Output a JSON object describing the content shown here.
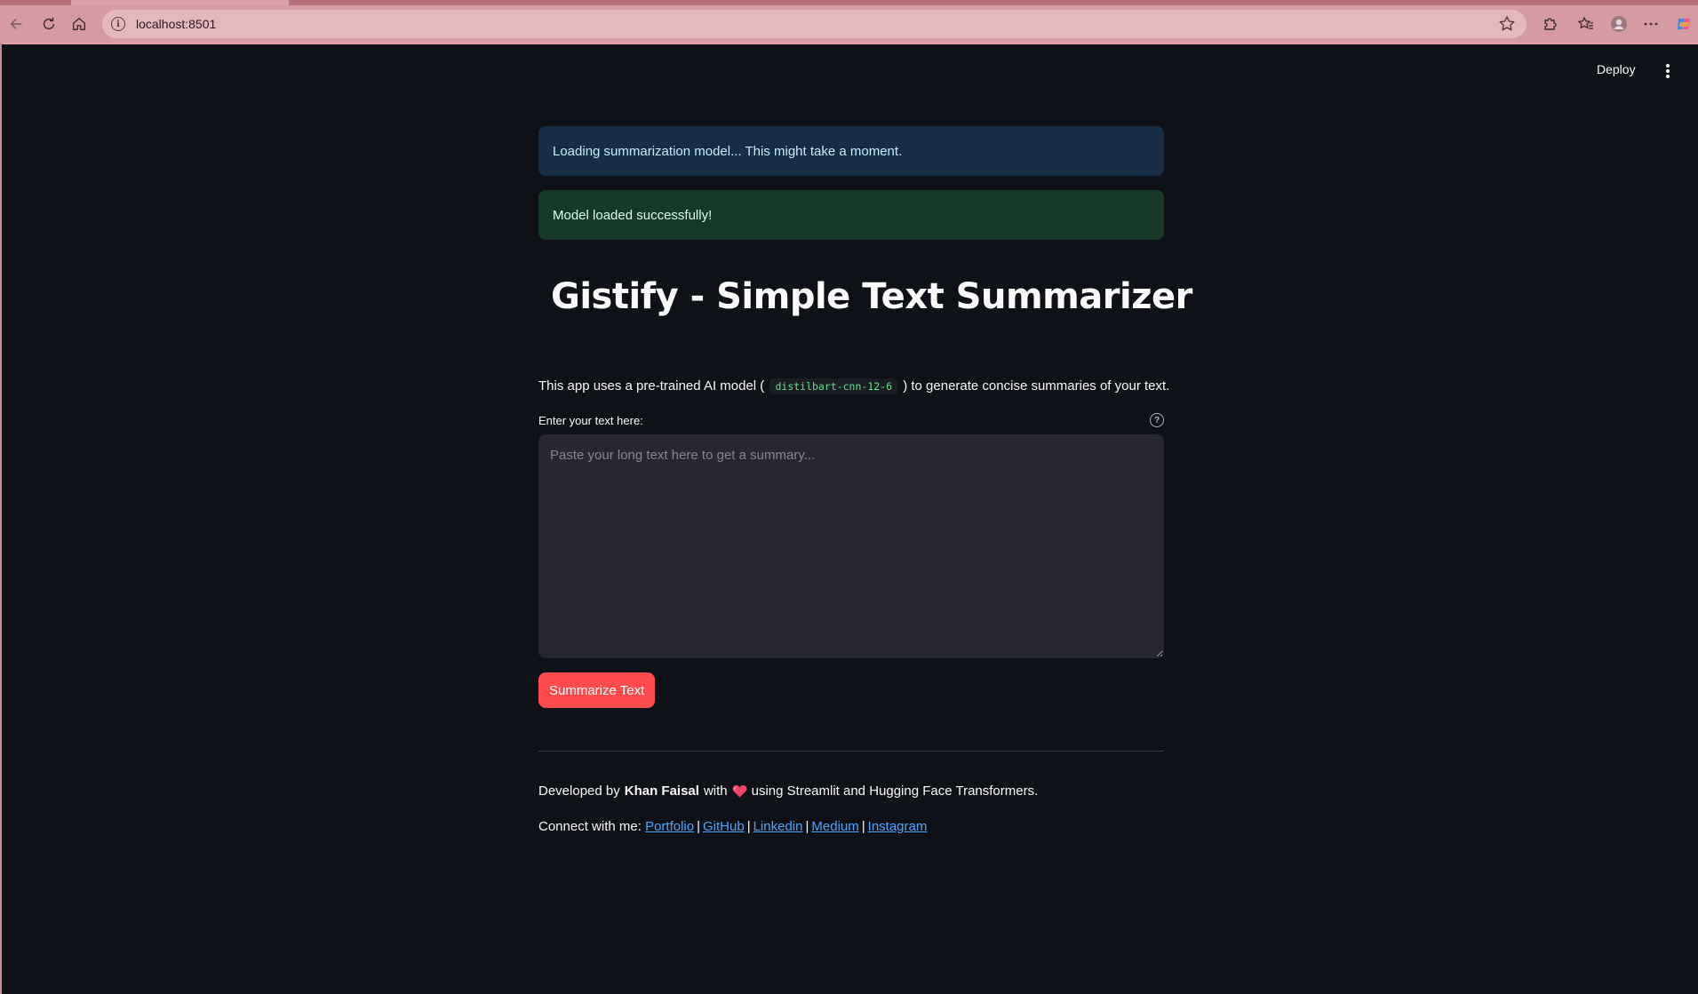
{
  "browser": {
    "url": "localhost:8501"
  },
  "header": {
    "deploy_label": "Deploy"
  },
  "alerts": {
    "info": "Loading summarization model... This might take a moment.",
    "success": "Model loaded successfully!"
  },
  "title": "Gistify - Simple Text Summarizer",
  "description": {
    "before": "This app uses a pre-trained AI model (",
    "model_code": "distilbart-cnn-12-6",
    "after": ") to generate concise summaries of your text."
  },
  "input": {
    "label": "Enter your text here:",
    "placeholder": "Paste your long text here to get a summary...",
    "value": ""
  },
  "button": {
    "summarize_label": "Summarize Text"
  },
  "footer": {
    "credit_prefix": "Developed by",
    "author": "Khan Faisal",
    "credit_with": "with",
    "credit_suffix": "using Streamlit and Hugging Face Transformers.",
    "connect_prefix": "Connect with me:",
    "links": [
      "Portfolio",
      "GitHub",
      "Linkedin",
      "Medium",
      "Instagram"
    ],
    "separator": "|"
  },
  "icons": {
    "back": "arrow-left-icon",
    "reload": "reload-icon",
    "home": "home-icon",
    "site_info": "info-icon",
    "favorite": "star-icon",
    "extensions": "puzzle-icon",
    "favorites_bar": "favorites-icon",
    "profile": "profile-icon",
    "more": "ellipsis-icon",
    "copilot": "copilot-icon",
    "title_emoji": "writing-hand-emoji",
    "heart": "heart-emoji",
    "help": "help-circle-icon"
  },
  "colors": {
    "app_background": "#0e1117",
    "info_background": "#172d43",
    "success_background": "#173928",
    "primary_button": "#ff4b4b",
    "link": "#4aa4ff",
    "code_text": "#5ce488",
    "browser_chrome": "#d69aa2"
  }
}
